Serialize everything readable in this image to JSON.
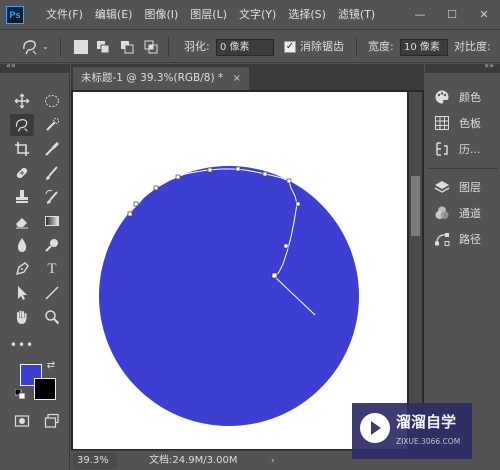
{
  "app": {
    "logo": "Ps",
    "menu": [
      "文件(F)",
      "编辑(E)",
      "图像(I)",
      "图层(L)",
      "文字(Y)",
      "选择(S)",
      "滤镜(T)"
    ],
    "window_controls": {
      "minimize": "—",
      "maximize": "☐",
      "close": "✕"
    }
  },
  "options": {
    "feather_label": "羽化:",
    "feather_value": "0 像素",
    "antialias_label": "消除锯齿",
    "antialias_checked": "✓",
    "width_label": "宽度:",
    "width_value": "10 像素",
    "contrast_label": "对比度:"
  },
  "document": {
    "tab_title": "未标题-1 @ 39.3%(RGB/8) *",
    "tab_close": "×",
    "zoom": "39.3%",
    "doc_info": "文档:24.9M/3.00M",
    "status_arrow": "›",
    "circle_color": "#3c3fd1",
    "canvas_color": "#ffffff"
  },
  "colors": {
    "foreground": "#3c3fd1",
    "background": "#000000"
  },
  "toolbar": {
    "tools": [
      "move-icon",
      "ellipse-marquee-icon",
      "magnetic-lasso-icon",
      "quick-selection-icon",
      "crop-icon",
      "eyedropper-icon",
      "healing-brush-icon",
      "brush-icon",
      "clone-stamp-icon",
      "history-brush-icon",
      "eraser-icon",
      "gradient-icon",
      "blur-icon",
      "dodge-icon",
      "pen-icon",
      "type-icon",
      "path-selection-icon",
      "line-icon",
      "hand-icon",
      "zoom-icon",
      "more-tools-icon"
    ]
  },
  "panels": {
    "group1": [
      {
        "label": "颜色",
        "icon": "color-palette-icon"
      },
      {
        "label": "色板",
        "icon": "swatches-grid-icon"
      },
      {
        "label": "历...",
        "icon": "history-icon"
      }
    ],
    "group2": [
      {
        "label": "图层",
        "icon": "layers-icon"
      },
      {
        "label": "通道",
        "icon": "channels-icon"
      },
      {
        "label": "路径",
        "icon": "paths-icon"
      }
    ]
  },
  "watermark": {
    "title": "溜溜自学",
    "subtitle": "ZIXUE.3066.COM"
  }
}
